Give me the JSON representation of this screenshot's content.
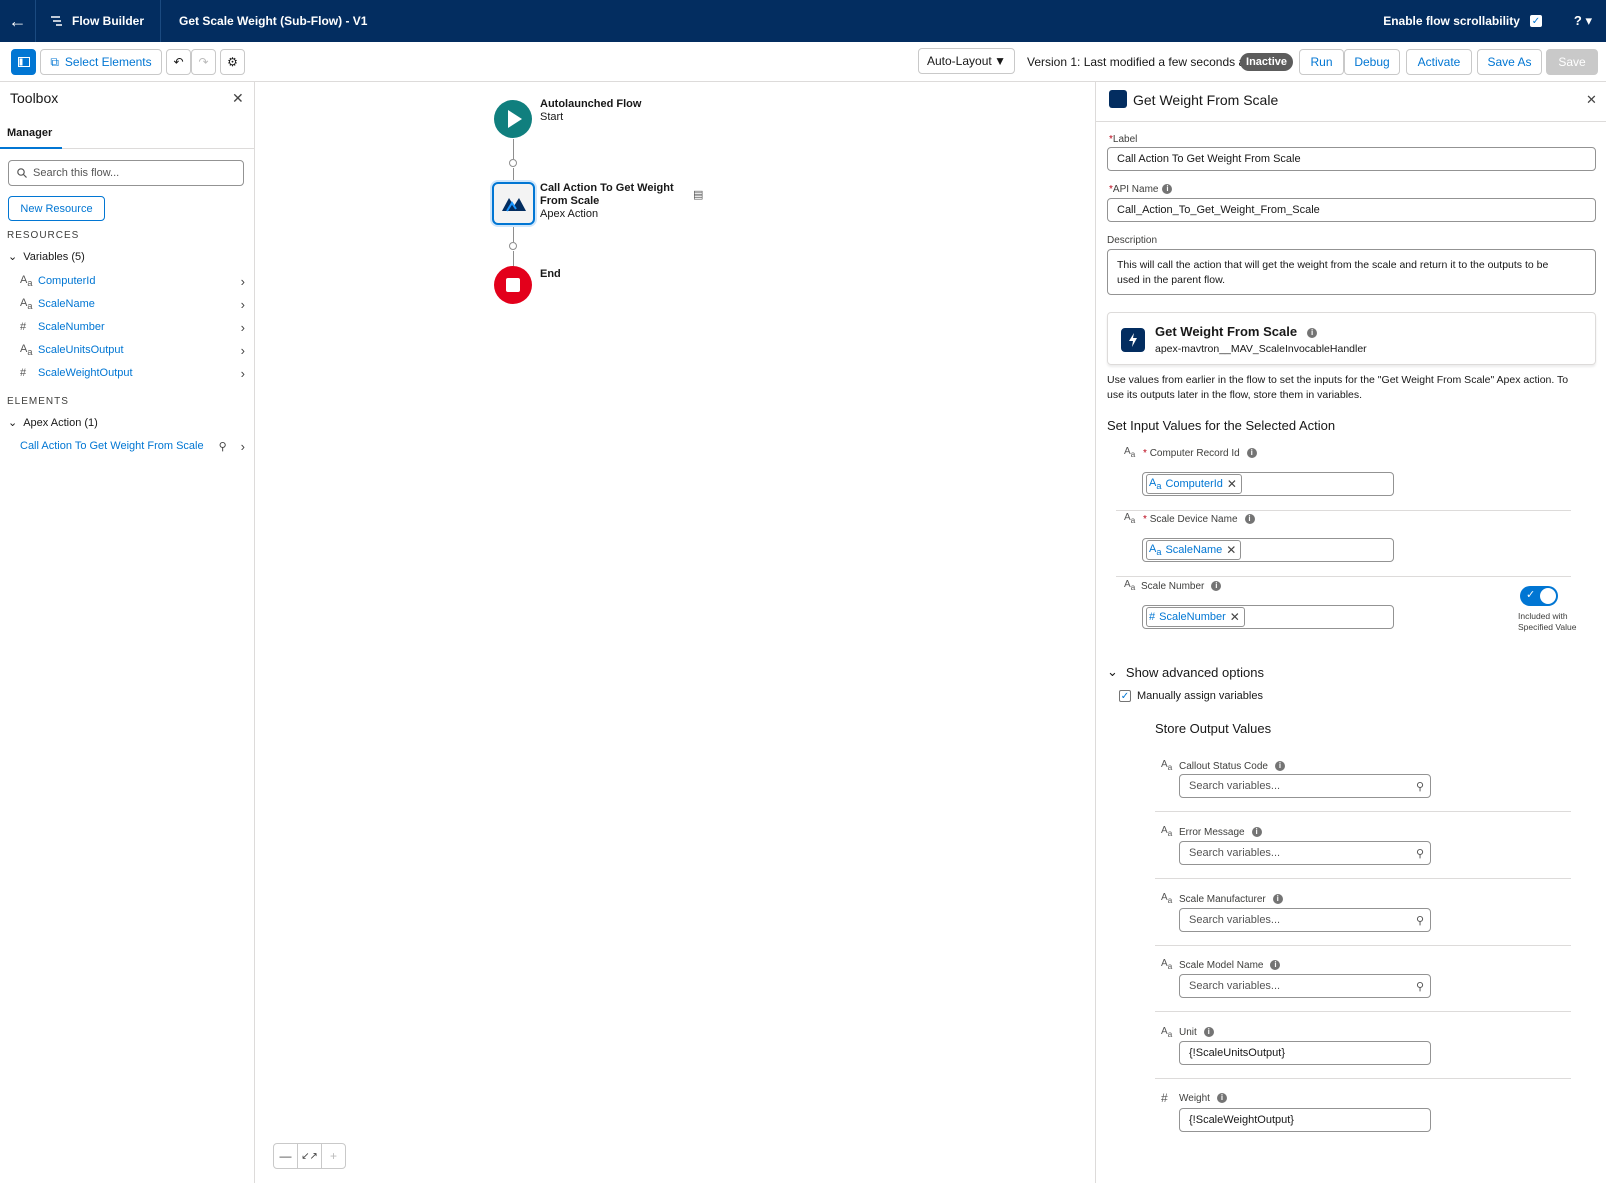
{
  "topbar": {
    "app_name": "Flow Builder",
    "flow_title": "Get Scale Weight (Sub-Flow) - V1",
    "scroll_label": "Enable flow scrollability",
    "help": "?"
  },
  "toolbar": {
    "select_elements": "Select Elements",
    "layout": "Auto-Layout",
    "version_text": "Version 1: Last modified a few seconds ago",
    "status": "Inactive",
    "run": "Run",
    "debug": "Debug",
    "activate": "Activate",
    "save_as": "Save As",
    "save": "Save"
  },
  "toolbox": {
    "title": "Toolbox",
    "tab": "Manager",
    "search_placeholder": "Search this flow...",
    "new_resource": "New Resource",
    "resources_heading": "RESOURCES",
    "variables_group": "Variables (5)",
    "variables": [
      {
        "name": "ComputerId",
        "type": "text"
      },
      {
        "name": "ScaleName",
        "type": "text"
      },
      {
        "name": "ScaleNumber",
        "type": "number"
      },
      {
        "name": "ScaleUnitsOutput",
        "type": "text"
      },
      {
        "name": "ScaleWeightOutput",
        "type": "number"
      }
    ],
    "elements_heading": "ELEMENTS",
    "apex_group": "Apex Action (1)",
    "apex_item": "Call Action To Get Weight From Scale"
  },
  "canvas": {
    "start_title": "Autolaunched Flow",
    "start_sub": "Start",
    "action_title_line1": "Call Action To Get Weight",
    "action_title_line2": "From Scale",
    "action_sub": "Apex Action",
    "end_title": "End",
    "colors": {
      "start": "#107f7e",
      "end": "#e3001b",
      "accent": "#0176d3"
    }
  },
  "panel": {
    "title": "Get Weight From Scale",
    "label_label": "Label",
    "label_value": "Call Action To Get Weight From Scale",
    "api_label": "API Name",
    "api_value": "Call_Action_To_Get_Weight_From_Scale",
    "desc_label": "Description",
    "desc_line1": "This will call the action that will get the weight from the scale and return it to the outputs to be",
    "desc_line2": "used in the parent flow.",
    "action_name": "Get Weight From Scale",
    "action_api": "apex-mavtron__MAV_ScaleInvocableHandler",
    "help_line1": "Use values from earlier in the flow to set the inputs for the \"Get Weight From Scale\" Apex action. To",
    "help_line2": "use its outputs later in the flow, store them in variables.",
    "inputs_heading": "Set Input Values for the Selected Action",
    "inputs": [
      {
        "label": "Computer Record Id",
        "value": "ComputerId",
        "required": "*"
      },
      {
        "label": "Scale Device Name",
        "value": "ScaleName",
        "required": "*"
      },
      {
        "label": "Scale Number",
        "value": "ScaleNumber",
        "required": ""
      }
    ],
    "toggle_line1": "Included with",
    "toggle_line2": "Specified Value",
    "advanced": "Show advanced options",
    "manual": "Manually assign variables",
    "outputs_heading": "Store Output Values",
    "outputs": [
      {
        "label": "Callout Status Code",
        "value": "",
        "placeholder": "Search variables..."
      },
      {
        "label": "Error Message",
        "value": "",
        "placeholder": "Search variables..."
      },
      {
        "label": "Scale Manufacturer",
        "value": "",
        "placeholder": "Search variables..."
      },
      {
        "label": "Scale Model Name",
        "value": "",
        "placeholder": "Search variables..."
      },
      {
        "label": "Unit",
        "value": "{!ScaleUnitsOutput}",
        "placeholder": ""
      },
      {
        "label": "Weight",
        "value": "{!ScaleWeightOutput}",
        "placeholder": ""
      }
    ]
  }
}
